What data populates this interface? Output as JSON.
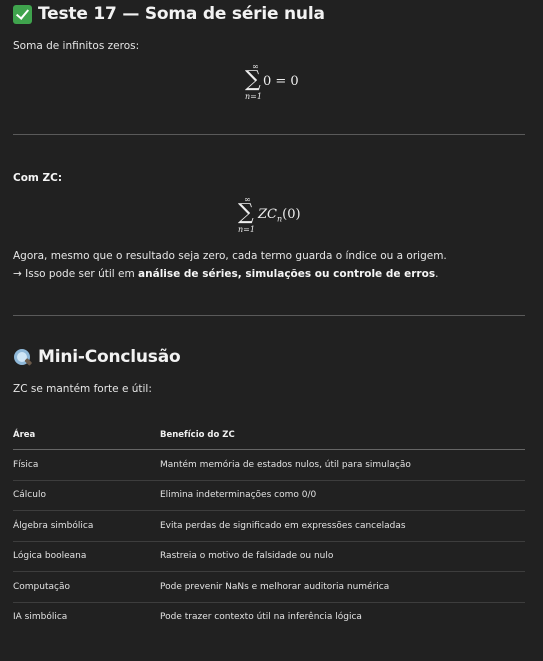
{
  "title": "Teste 17 — Soma de série nula",
  "intro": "Soma de infinitos zeros:",
  "formula1": {
    "upper": "∞",
    "lower": "n=1",
    "body": "0 = 0"
  },
  "zc_label": "Com ZC:",
  "formula2": {
    "upper": "∞",
    "lower": "n=1",
    "body_main": "ZC",
    "body_sub": "n",
    "body_arg": "(0)"
  },
  "para1": "Agora, mesmo que o resultado seja zero, cada termo guarda o índice ou a origem.",
  "para2_prefix": "→ Isso pode ser útil em ",
  "para2_bold": "análise de séries, simulações ou controle de erros",
  "para2_suffix": ".",
  "mini_title": "Mini-Conclusão",
  "mini_text": "ZC se mantém forte e útil:",
  "table": {
    "headers": [
      "Área",
      "Benefício do ZC"
    ],
    "rows": [
      [
        "Física",
        "Mantém memória de estados nulos, útil para simulação"
      ],
      [
        "Cálculo",
        "Elimina indeterminações como 0/0"
      ],
      [
        "Álgebra simbólica",
        "Evita perdas de significado em expressões canceladas"
      ],
      [
        "Lógica booleana",
        "Rastreia o motivo de falsidade ou nulo"
      ],
      [
        "Computação",
        "Pode prevenir NaNs e melhorar auditoria numérica"
      ],
      [
        "IA simbólica",
        "Pode trazer contexto útil na inferência lógica"
      ]
    ]
  },
  "icons": {
    "title_icon": "check-mark-button-icon",
    "mini_icon": "magnifying-glass-icon"
  }
}
